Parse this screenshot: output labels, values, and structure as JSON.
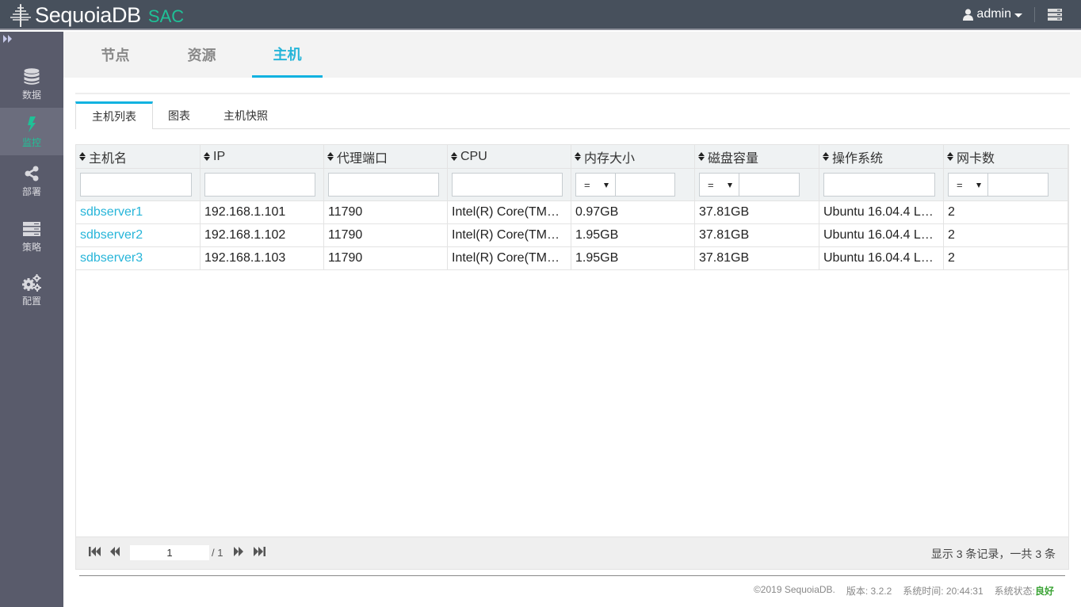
{
  "header": {
    "brand": "SequoiaDB",
    "product": "SAC",
    "user": "admin",
    "colors": {
      "bar": "#47505c",
      "accent": "#1fc197"
    }
  },
  "sidebar": {
    "toggle_icon": "double-chevron-right-icon",
    "items": [
      {
        "label": "数据",
        "icon": "database-icon",
        "active": false
      },
      {
        "label": "监控",
        "icon": "lightning-icon",
        "active": true
      },
      {
        "label": "部署",
        "icon": "share-icon",
        "active": false
      },
      {
        "label": "策略",
        "icon": "server-stack-icon",
        "active": false
      },
      {
        "label": "配置",
        "icon": "gears-icon",
        "active": false
      }
    ]
  },
  "main_tabs": [
    {
      "label": "节点",
      "active": false
    },
    {
      "label": "资源",
      "active": false
    },
    {
      "label": "主机",
      "active": true
    }
  ],
  "sub_tabs": [
    {
      "label": "主机列表",
      "active": true
    },
    {
      "label": "图表",
      "active": false
    },
    {
      "label": "主机快照",
      "active": false
    }
  ],
  "grid": {
    "columns": [
      {
        "label": "主机名",
        "filter": "text"
      },
      {
        "label": "IP",
        "filter": "text"
      },
      {
        "label": "代理端口",
        "filter": "text"
      },
      {
        "label": "CPU",
        "filter": "text"
      },
      {
        "label": "内存大小",
        "filter": "operator",
        "operator": "="
      },
      {
        "label": "磁盘容量",
        "filter": "operator",
        "operator": "="
      },
      {
        "label": "操作系统",
        "filter": "text"
      },
      {
        "label": "网卡数",
        "filter": "operator",
        "operator": "="
      }
    ],
    "rows": [
      [
        "sdbserver1",
        "192.168.1.101",
        "11790",
        "Intel(R) Core(TM…",
        "0.97GB",
        "37.81GB",
        "Ubuntu 16.04.4 L…",
        "2"
      ],
      [
        "sdbserver2",
        "192.168.1.102",
        "11790",
        "Intel(R) Core(TM…",
        "1.95GB",
        "37.81GB",
        "Ubuntu 16.04.4 L…",
        "2"
      ],
      [
        "sdbserver3",
        "192.168.1.103",
        "11790",
        "Intel(R) Core(TM…",
        "1.95GB",
        "37.81GB",
        "Ubuntu 16.04.4 L…",
        "2"
      ]
    ],
    "pager": {
      "current_page": "1",
      "total_pages": "/ 1",
      "info": "显示 3 条记录，一共 3 条"
    }
  },
  "footer": {
    "copyright": "©2019 SequoiaDB.",
    "version": "版本: 3.2.2",
    "time": "系统时间: 20:44:31",
    "status_label": "系统状态:",
    "status_value": "良好",
    "status_color": "#3aa334"
  }
}
